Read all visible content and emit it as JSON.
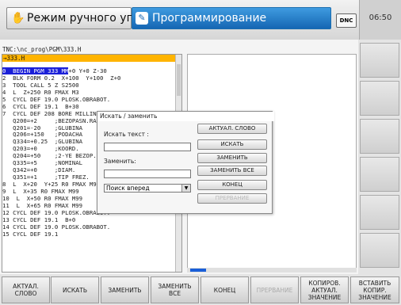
{
  "header": {
    "machine_mode": "Режим ручного уп...",
    "programming_mode": "Программирование",
    "dnc_label": "DNC",
    "clock": "06:50"
  },
  "program": {
    "path": "TNC:\\nc_prog\\PGM\\333.H",
    "file": "→333.H",
    "lines": [
      "0  BEGIN PGM 333 MM",
      "1  BLK FORM 0.1 Z X+0 Y+0 Z-30",
      "2  BLK FORM 0.2  X+100  Y+100  Z+0",
      "3  TOOL CALL 5 Z S2500",
      "4  L  Z+250 R0 FMAX M3",
      "5  CYCL DEF 19.0 PLOSK.OBRABOT.",
      "6  CYCL DEF 19.1  B+30",
      "7  CYCL DEF 208 BORE MILLING",
      "   Q200=+2     ;BEZOPASN.RASST.",
      "   Q201=-20    ;GLUBINA",
      "   Q206=+150   ;PODACHA",
      "   Q334=+0.25  ;GLUBINA",
      "   Q203=+0     ;KOORD.",
      "   Q204=+50    ;2-YE BEZOP.",
      "   Q335=+5     ;NOMINAL",
      "   Q342=+0     ;DIAM.",
      "   Q351=+1     ;TIP FREZ.",
      "8  L  X+20  Y+25 R0 FMAX M99",
      "9  L  X+35 R0 FMAX M99",
      "10  L  X+50 R0 FMAX M99",
      "11  L  X+65 R0 FMAX M99",
      "12 CYCL DEF 19.0 PLOSK.OBRABOT.",
      "13 CYCL DEF 19.1  B+0",
      "14 CYCL DEF 19.0 PLOSK.OBRABOT.",
      "15 CYCL DEF 19.1"
    ]
  },
  "dialog": {
    "title": "Искать / заменить",
    "search_label": "Искать текст :",
    "replace_label": "Заменить:",
    "direction": "Поиск вперед",
    "buttons": [
      "АКТУАЛ. СЛОВО",
      "ИСКАТЬ",
      "ЗАМЕНИТЬ",
      "ЗАМЕНИТЬ ВСЕ",
      "КОНЕЦ",
      "ПРЕРВАНИЕ"
    ]
  },
  "softkeys": [
    {
      "label": "АКТУАЛ.\nСЛОВО",
      "enabled": true
    },
    {
      "label": "ИСКАТЬ",
      "enabled": true
    },
    {
      "label": "ЗАМЕНИТЬ",
      "enabled": true
    },
    {
      "label": "ЗАМЕНИТЬ ВСЕ",
      "enabled": true
    },
    {
      "label": "КОНЕЦ",
      "enabled": true
    },
    {
      "label": "ПРЕРВАНИЕ",
      "enabled": false
    },
    {
      "label": "КОПИРОВ.\nАКТУАЛ.\nЗНАЧЕНИЕ",
      "enabled": true
    },
    {
      "label": "ВСТАВИТЬ\nКОПИР.\nЗНАЧЕНИЕ",
      "enabled": true
    }
  ],
  "colors": {
    "accent": "#1566b3",
    "file_bar": "#ffb400",
    "selection": "#1a1fd8"
  }
}
